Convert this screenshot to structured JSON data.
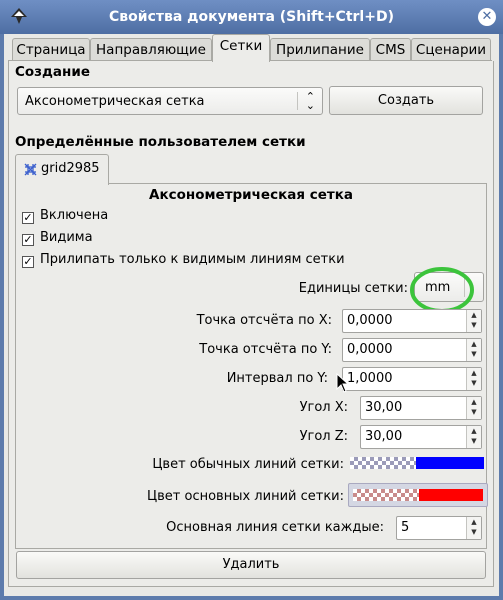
{
  "window": {
    "title": "Свойства документа (Shift+Ctrl+D)"
  },
  "tabs": [
    {
      "label": "Страница"
    },
    {
      "label": "Направляющие"
    },
    {
      "label": "Сетки"
    },
    {
      "label": "Прилипание"
    },
    {
      "label": "CMS"
    },
    {
      "label": "Сценарии"
    }
  ],
  "creation": {
    "heading": "Создание",
    "grid_type": "Аксонометрическая сетка",
    "create_label": "Создать"
  },
  "user_grids": {
    "heading": "Определённые пользователем сетки",
    "tab_label": "grid2985"
  },
  "grid": {
    "heading": "Аксонометрическая сетка",
    "enabled_label": "Включена",
    "visible_label": "Видима",
    "snap_label": "Прилипать только к видимым линиям сетки",
    "units_label": "Единицы сетки:",
    "units_value": "mm",
    "origin_x_label": "Точка отсчёта по X:",
    "origin_x_value": "0,0000",
    "origin_y_label": "Точка отсчёта по Y:",
    "origin_y_value": "0,0000",
    "spacing_y_label": "Интервал по Y:",
    "spacing_y_value": "1,0000",
    "angle_x_label": "Угол X:",
    "angle_x_value": "30,00",
    "angle_z_label": "Угол Z:",
    "angle_z_value": "30,00",
    "minor_color_label": "Цвет обычных линий сетки:",
    "major_color_label": "Цвет основных линий сетки:",
    "major_every_label": "Основная линия сетки каждые:",
    "major_every_value": "5",
    "delete_label": "Удалить"
  },
  "colors": {
    "minor_line": "#0000ff",
    "major_line": "#ff0000",
    "highlight_circle": "#3cc43c"
  }
}
